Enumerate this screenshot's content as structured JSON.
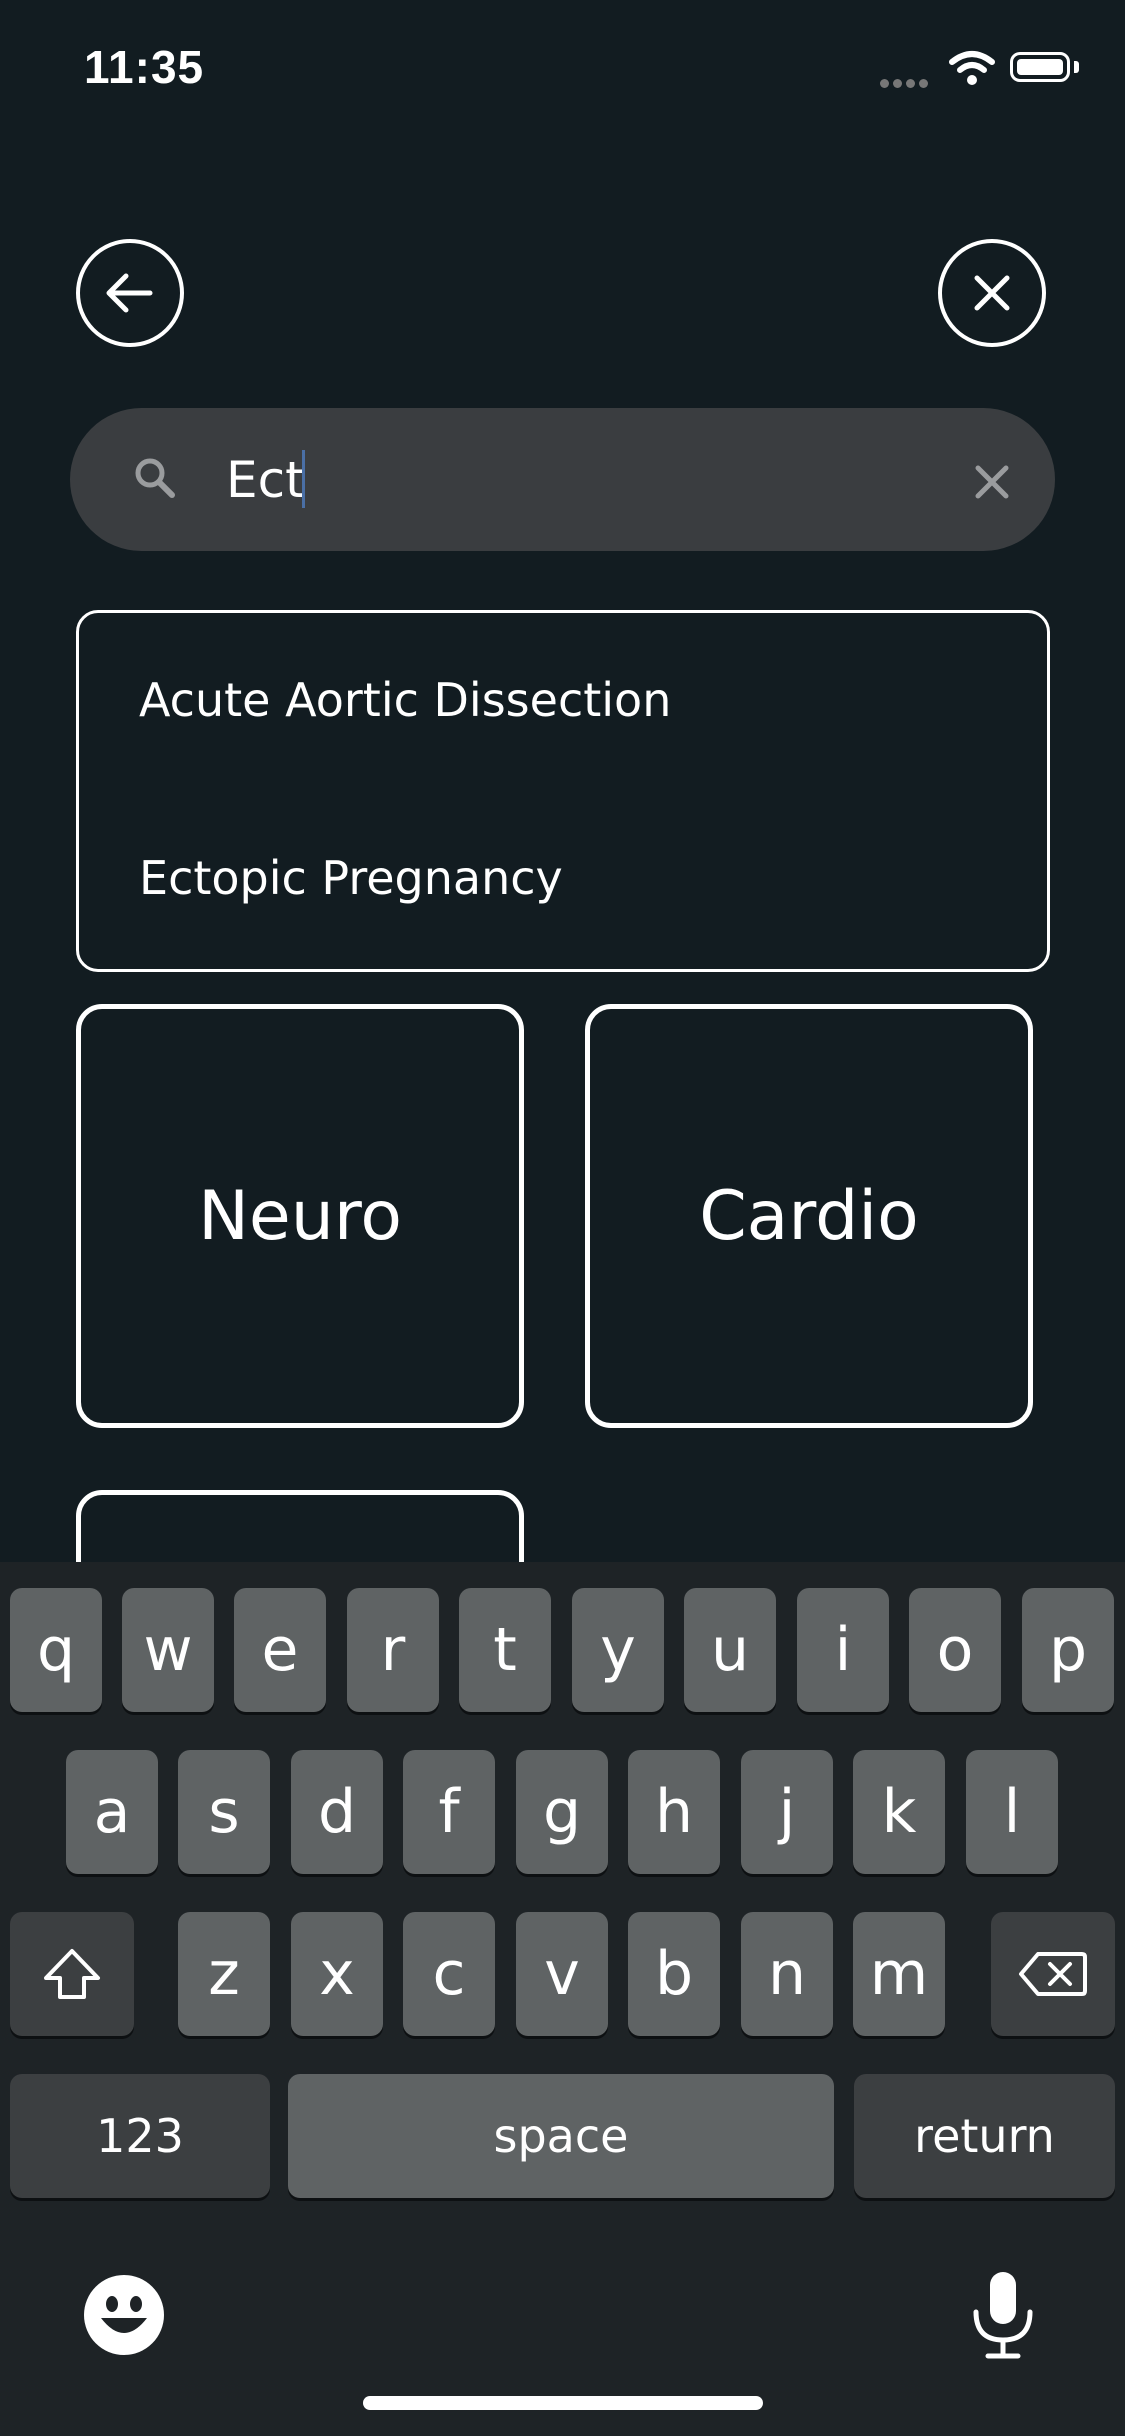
{
  "status": {
    "time": "11:35"
  },
  "search": {
    "value": "Ect"
  },
  "results": [
    "Acute Aortic Dissection",
    "Ectopic Pregnancy"
  ],
  "categories": [
    "Neuro",
    "Cardio"
  ],
  "keyboard": {
    "row1": [
      "q",
      "w",
      "e",
      "r",
      "t",
      "y",
      "u",
      "i",
      "o",
      "p"
    ],
    "row2": [
      "a",
      "s",
      "d",
      "f",
      "g",
      "h",
      "j",
      "k",
      "l"
    ],
    "row3": [
      "z",
      "x",
      "c",
      "v",
      "b",
      "n",
      "m"
    ],
    "numbers_label": "123",
    "space_label": "space",
    "return_label": "return"
  },
  "icons": {
    "back": "arrow-left-icon",
    "close": "close-icon",
    "search": "search-icon",
    "clear": "clear-icon",
    "shift": "shift-icon",
    "delete": "backspace-icon",
    "emoji": "emoji-icon",
    "mic": "microphone-icon"
  }
}
